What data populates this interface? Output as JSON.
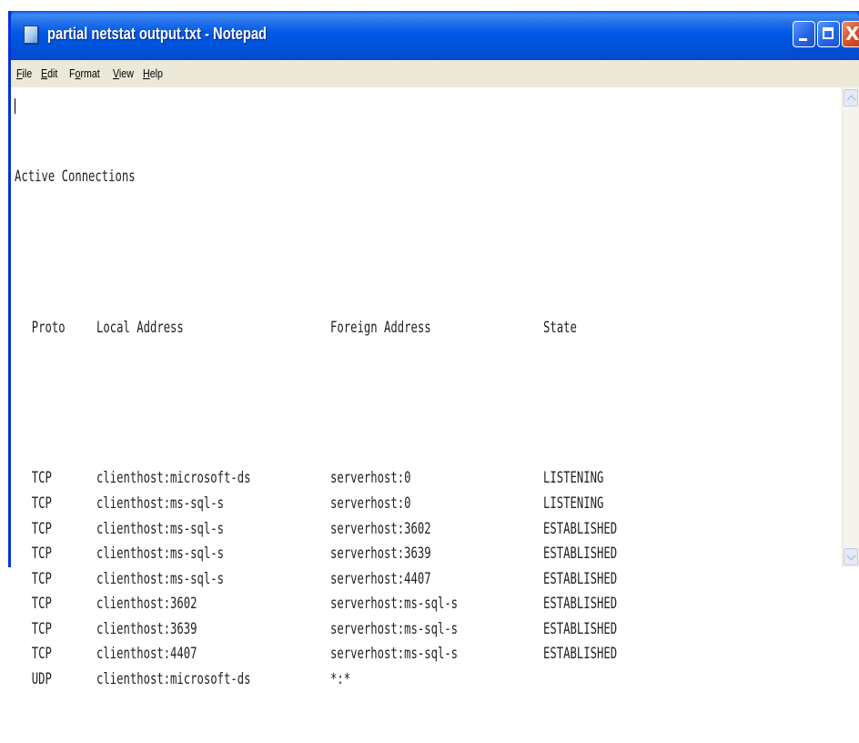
{
  "window": {
    "title": "partial netstat output.txt - Notepad",
    "icons": {
      "app": "notepad-icon",
      "minimize": "minimize-icon",
      "maximize": "maximize-icon",
      "close": "close-icon",
      "close_glyph": "X"
    }
  },
  "menu": {
    "file": {
      "u": "F",
      "rest": "ile"
    },
    "edit": {
      "u": "E",
      "rest": "dit"
    },
    "format": {
      "pre": "F",
      "u": "o",
      "rest": "rmat"
    },
    "view": {
      "u": "V",
      "rest": "iew"
    },
    "help": {
      "u": "H",
      "rest": "elp"
    }
  },
  "document": {
    "heading": "Active Connections",
    "columns": {
      "proto": "Proto",
      "local": "Local Address",
      "foreign": "Foreign Address",
      "state": "State"
    },
    "rows": [
      {
        "proto": "TCP",
        "local": "clienthost:microsoft-ds",
        "foreign": "serverhost:0",
        "state": "LISTENING"
      },
      {
        "proto": "TCP",
        "local": "clienthost:ms-sql-s",
        "foreign": "serverhost:0",
        "state": "LISTENING"
      },
      {
        "proto": "TCP",
        "local": "clienthost:ms-sql-s",
        "foreign": "serverhost:3602",
        "state": "ESTABLISHED"
      },
      {
        "proto": "TCP",
        "local": "clienthost:ms-sql-s",
        "foreign": "serverhost:3639",
        "state": "ESTABLISHED"
      },
      {
        "proto": "TCP",
        "local": "clienthost:ms-sql-s",
        "foreign": "serverhost:4407",
        "state": "ESTABLISHED"
      },
      {
        "proto": "TCP",
        "local": "clienthost:3602",
        "foreign": "serverhost:ms-sql-s",
        "state": "ESTABLISHED"
      },
      {
        "proto": "TCP",
        "local": "clienthost:3639",
        "foreign": "serverhost:ms-sql-s",
        "state": "ESTABLISHED"
      },
      {
        "proto": "TCP",
        "local": "clienthost:4407",
        "foreign": "serverhost:ms-sql-s",
        "state": "ESTABLISHED"
      },
      {
        "proto": "UDP",
        "local": "clienthost:microsoft-ds",
        "foreign": "*:*",
        "state": ""
      }
    ]
  },
  "scrollbar": {
    "up_icon": "scroll-up-arrow-icon",
    "down_icon": "scroll-down-arrow-icon"
  },
  "colors": {
    "titlebar": "#0058e6",
    "menubar": "#ece9d8",
    "close_button": "#d8502c",
    "text": "#222222"
  }
}
